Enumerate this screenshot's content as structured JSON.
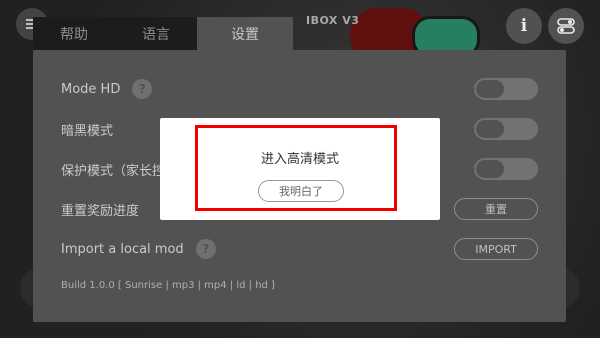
{
  "background": {
    "title": "IBOX V3"
  },
  "top_icons": {
    "left_icon": "menu-icon",
    "info_icon": "info-icon",
    "toggle_icon": "settings-toggle-icon"
  },
  "tabs": [
    {
      "label": "帮助"
    },
    {
      "label": "语言"
    },
    {
      "label": "设置"
    }
  ],
  "settings": {
    "rows": [
      {
        "label": "Mode HD",
        "help": "?"
      },
      {
        "label": "暗黑模式"
      },
      {
        "label": "保护模式（家长控"
      },
      {
        "label": "重置奖励进度",
        "button": "重置"
      },
      {
        "label": "Import a local mod",
        "help": "?",
        "button": "IMPORT"
      }
    ],
    "build": "Build 1.0.0 [ Sunrise | mp3 | mp4 | ld | hd ]"
  },
  "modal": {
    "message": "进入高清模式",
    "button": "我明白了"
  },
  "colors": {
    "panel": "#5a5a5a",
    "highlight": "#ef0000"
  }
}
